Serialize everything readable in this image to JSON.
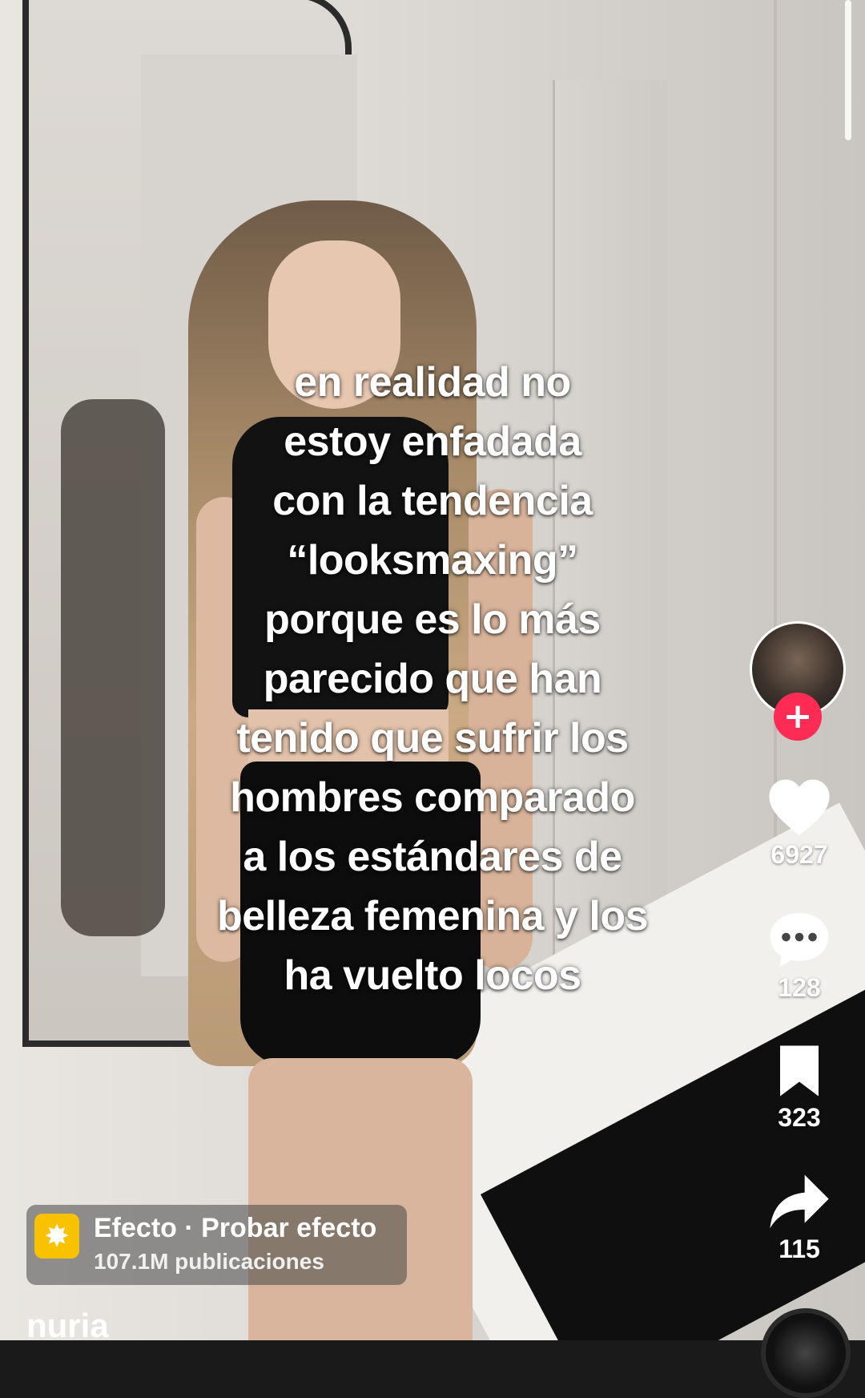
{
  "caption_lines": [
    "en realidad no",
    "estoy enfadada",
    "con la tendencia",
    "“looksmaxing”",
    "porque es lo más",
    "parecido que han",
    "tenido que sufrir los",
    "hombres comparado",
    "a los estándares de",
    "belleza femenina y los",
    "ha vuelto locos"
  ],
  "actions": {
    "follow_symbol": "+",
    "likes": "6927",
    "comments": "128",
    "bookmarks": "323",
    "shares": "115"
  },
  "effect": {
    "title": "Efecto · Probar efecto",
    "subtitle": "107.1M publicaciones",
    "icon": "sparkle-icon"
  },
  "username": "nuria",
  "colors": {
    "follow_button": "#fe2c55",
    "effect_icon": "#f8c200",
    "text": "#ffffff"
  }
}
